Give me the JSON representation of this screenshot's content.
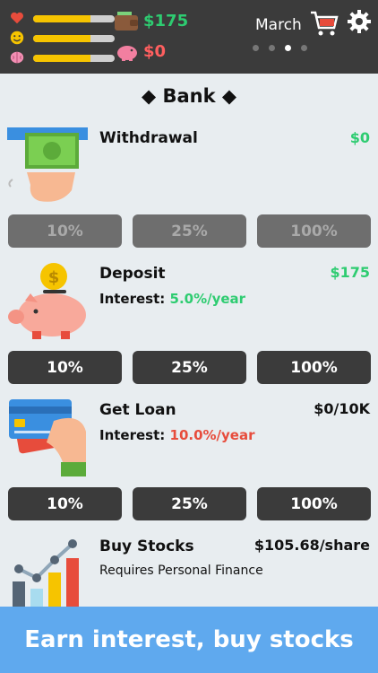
{
  "status": {
    "health_level": 0.7,
    "happiness_level": 0.7,
    "smarts_level": 0.7,
    "cash": "$175",
    "debt": "$0",
    "month": "March",
    "page_dots": 4,
    "active_dot": 2,
    "icons": [
      "heart-icon",
      "smiley-icon",
      "brain-icon",
      "wallet-icon",
      "piggy-bank-icon",
      "cart-icon",
      "gear-icon"
    ]
  },
  "bank": {
    "title": "◆ Bank ◆"
  },
  "withdrawal": {
    "title": "Withdrawal",
    "value": "$0",
    "buttons": [
      "10%",
      "25%",
      "100%"
    ]
  },
  "deposit": {
    "title": "Deposit",
    "value": "$175",
    "interest_label": "Interest:",
    "interest_rate": "5.0%/year",
    "buttons": [
      "10%",
      "25%",
      "100%"
    ]
  },
  "loan": {
    "title": "Get Loan",
    "value": "$0/10K",
    "interest_label": "Interest:",
    "interest_rate": "10.0%/year",
    "buttons": [
      "10%",
      "25%",
      "100%"
    ]
  },
  "stocks": {
    "title": "Buy Stocks",
    "value": "$105.68/share",
    "note": "Requires Personal Finance"
  },
  "banner": {
    "text": "Earn interest, buy stocks"
  },
  "colors": {
    "topbar": "#3b3b3b",
    "background": "#e8edf0",
    "accent_green": "#2ecc71",
    "accent_red": "#e74c3c",
    "banner": "#5fa9ee",
    "bar_fill": "#f6c400"
  }
}
